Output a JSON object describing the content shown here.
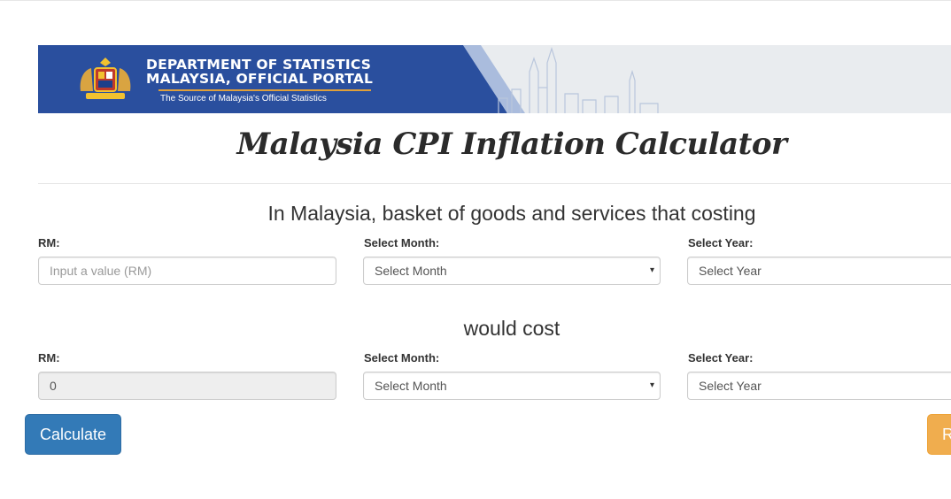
{
  "banner": {
    "line1": "DEPARTMENT OF STATISTICS",
    "line2": "MALAYSIA, OFFICIAL PORTAL",
    "tagline": "The Source of Malaysia's Official Statistics"
  },
  "title": "Malaysia CPI Inflation Calculator",
  "section1": {
    "heading": "In Malaysia, basket of goods and services that costing",
    "rm_label": "RM:",
    "rm_placeholder": "Input a value (RM)",
    "month_label": "Select Month:",
    "month_value": "Select Month",
    "year_label": "Select Year:",
    "year_value": "Select Year"
  },
  "section2": {
    "heading": "would cost",
    "rm_label": "RM:",
    "rm_value": "0",
    "month_label": "Select Month:",
    "month_value": "Select Month",
    "year_label": "Select Year:",
    "year_value": "Select Year"
  },
  "buttons": {
    "calculate": "Calculate",
    "reset_partial": "R"
  },
  "colors": {
    "banner_blue": "#2a4f9e",
    "primary": "#337ab7",
    "warning": "#f0ad4e"
  },
  "icons": {
    "caret": "▾"
  }
}
